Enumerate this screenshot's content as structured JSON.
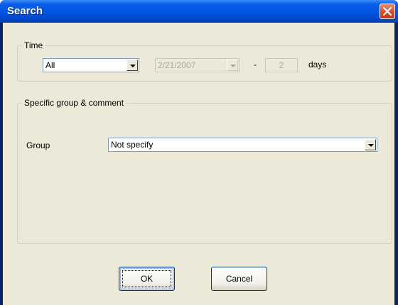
{
  "window": {
    "title": "Search"
  },
  "time_group": {
    "legend": "Time",
    "period_select": {
      "value": "All"
    },
    "date_select": {
      "value": "2/21/2007"
    },
    "separator": "-",
    "days_input": {
      "value": "2"
    },
    "days_label": "days"
  },
  "group_section": {
    "legend": "Specific group & comment",
    "group_label": "Group",
    "group_select": {
      "value": "Not specify"
    }
  },
  "buttons": {
    "ok": "OK",
    "cancel": "Cancel"
  }
}
